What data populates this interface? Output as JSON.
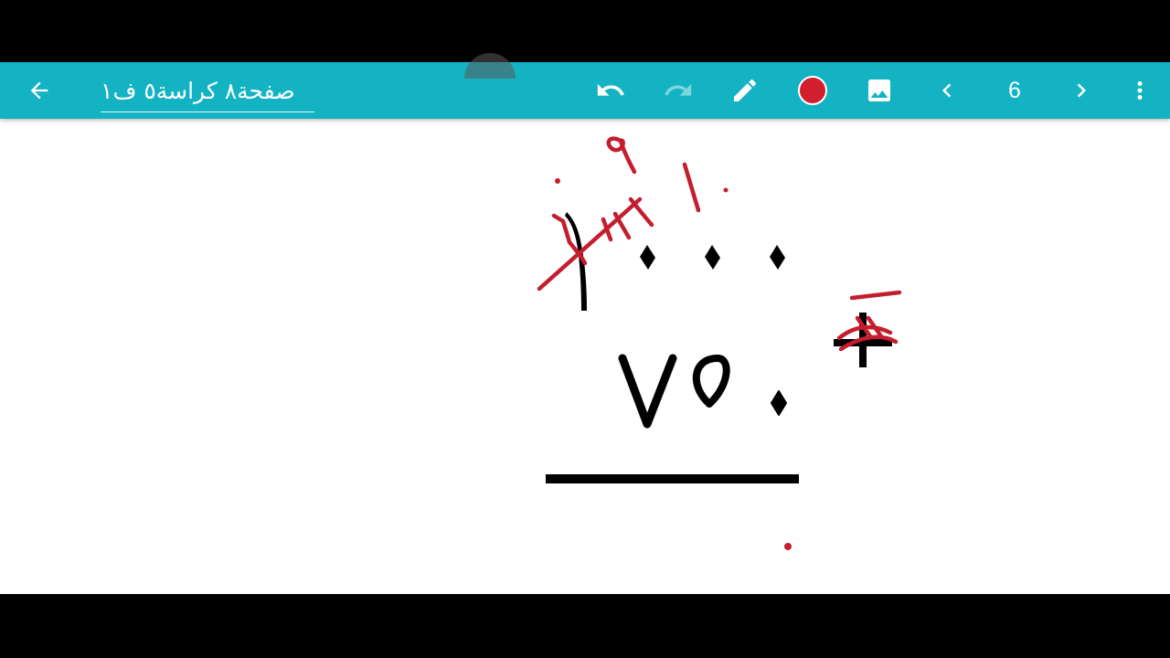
{
  "toolbar": {
    "title": "صفحة٨ كراسة٥ ف١",
    "page_number": "6",
    "current_color": "#d11f2e",
    "icons": [
      "back-arrow-icon",
      "undo-icon",
      "redo-icon",
      "pencil-icon",
      "color-swatch",
      "image-icon",
      "chevron-left-icon",
      "chevron-right-icon",
      "more-vert-icon"
    ]
  },
  "canvas": {
    "printed_numerals": {
      "top_number": "١٠٠٠",
      "second_number": "٧٥٠",
      "operator": "+"
    },
    "annotations": {
      "carry_nine": "٩",
      "carry_one_zero": "١٠",
      "ink_color": "#c41e2e"
    }
  }
}
